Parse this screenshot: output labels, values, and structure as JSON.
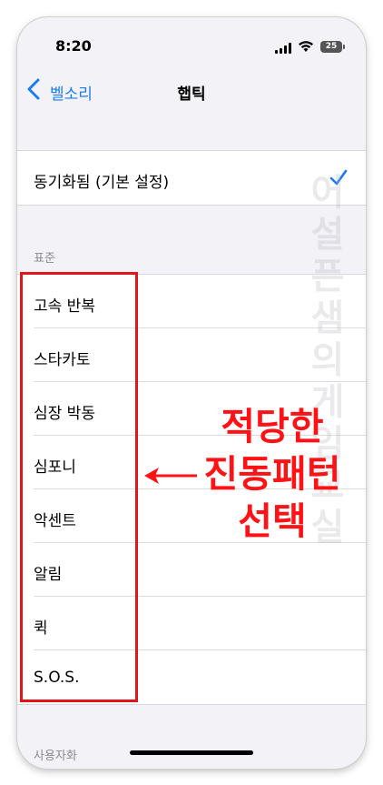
{
  "status_bar": {
    "time": "8:20",
    "battery": "25"
  },
  "nav": {
    "back_label": "벨소리",
    "title": "햅틱"
  },
  "synced": {
    "label": "동기화됨 (기본 설정)",
    "selected": true
  },
  "standard": {
    "header": "표준",
    "items": [
      "고속 반복",
      "스타카토",
      "심장 박동",
      "심포니",
      "악센트",
      "알림",
      "퀵",
      "S.O.S."
    ]
  },
  "custom": {
    "header": "사용자화"
  },
  "annotation": {
    "lines": [
      "적당한",
      "진동패턴",
      "선택"
    ]
  },
  "watermark": "어설픈샘의게임교실",
  "colors": {
    "accent": "#1a7cf2",
    "highlight": "#e0161a",
    "annotation": "#ff1216"
  }
}
